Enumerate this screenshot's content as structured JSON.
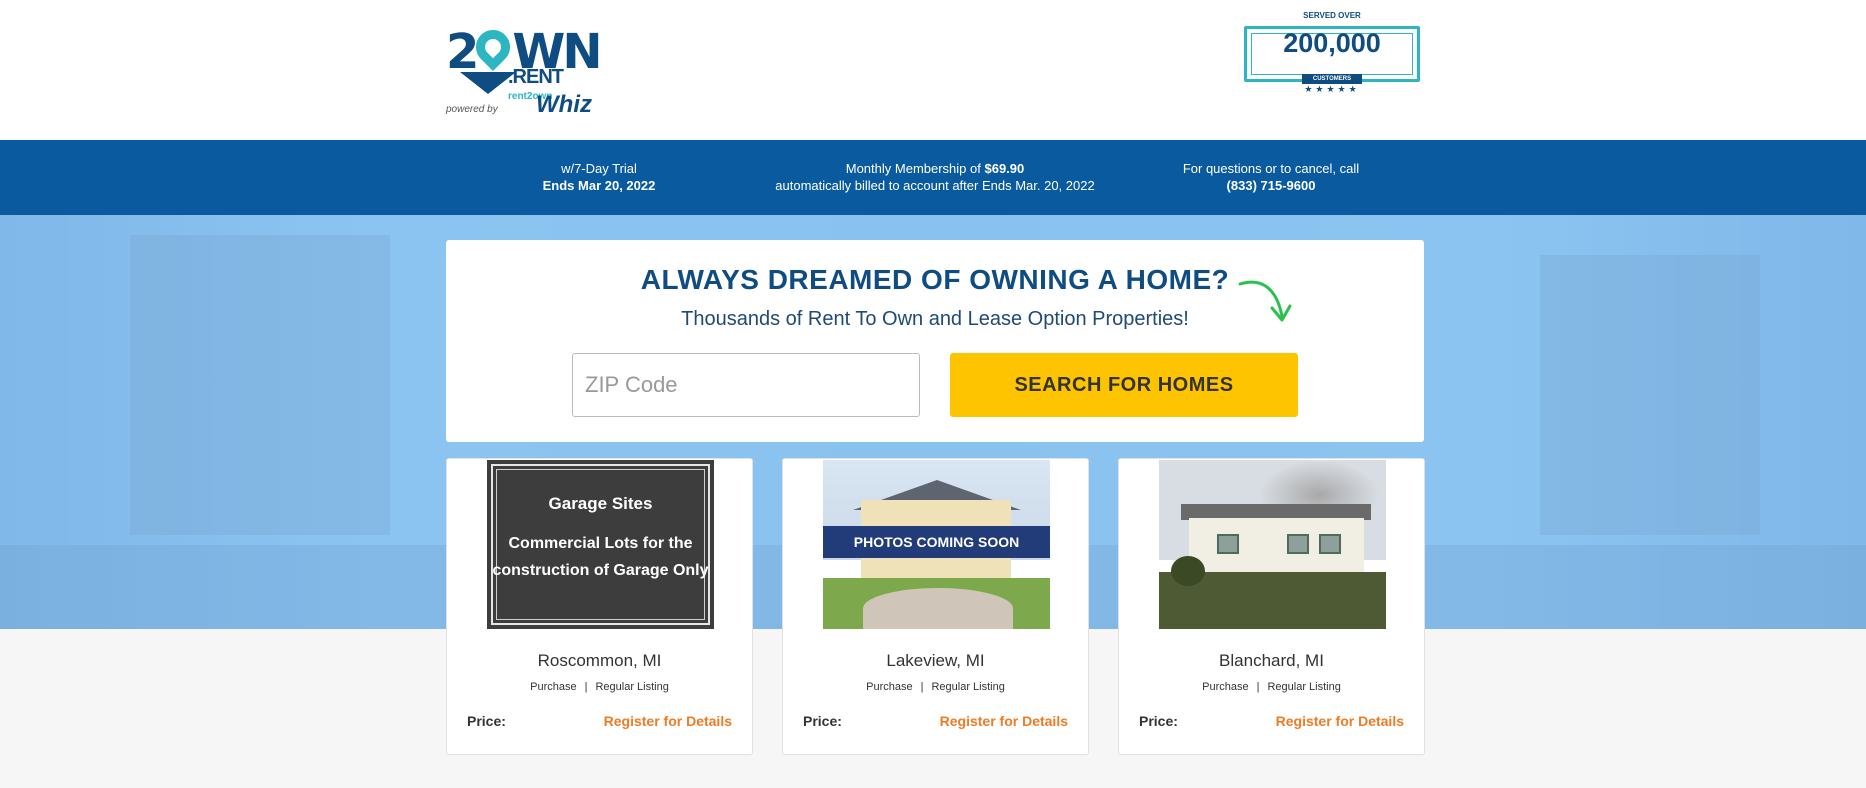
{
  "header": {
    "logo": {
      "brand_top": "2OWN",
      "brand_bottom": ".RENT",
      "powered_by": "powered by",
      "partner_small": "rent2own",
      "partner_main": "Whiz"
    },
    "badge": {
      "top_text": "SERVED OVER",
      "number": "200,000",
      "ribbon": "CUSTOMERS",
      "stars": "★★★★★"
    }
  },
  "infobar": {
    "trial_line1": "w/7-Day Trial",
    "trial_line2": "Ends Mar 20, 2022",
    "membership_prefix": "Monthly Membership of ",
    "membership_price": "$69.90",
    "membership_line2": "automatically billed to account after Ends Mar. 20, 2022",
    "contact_line1": "For questions or to cancel, call",
    "contact_phone": "(833) 715-9600"
  },
  "search": {
    "title": "ALWAYS DREAMED OF OWNING A HOME?",
    "subtitle": "Thousands of Rent To Own and Lease Option Properties!",
    "zip_placeholder": "ZIP Code",
    "zip_value": "",
    "button_label": "SEARCH FOR HOMES"
  },
  "listings": [
    {
      "sign_title": "Garage Sites",
      "sign_body": "Commercial Lots for the construction of Garage Only",
      "city": "Roscommon, MI",
      "type": "Purchase",
      "category": "Regular Listing",
      "price_label": "Price:",
      "price_link": "Register for Details"
    },
    {
      "banner": "PHOTOS COMING SOON",
      "city": "Lakeview, MI",
      "type": "Purchase",
      "category": "Regular Listing",
      "price_label": "Price:",
      "price_link": "Register for Details"
    },
    {
      "city": "Blanchard, MI",
      "type": "Purchase",
      "category": "Regular Listing",
      "price_label": "Price:",
      "price_link": "Register for Details"
    }
  ],
  "colors": {
    "brand_navy": "#0f4c81",
    "brand_teal": "#2bb6c2",
    "infobar": "#0a5aa0",
    "cta_yellow": "#ffc400",
    "link_orange": "#f07b22",
    "hero_blue": "#8ac2ef"
  },
  "icons": {
    "logo_pin": "map-pin-icon",
    "arrow": "curved-arrow-icon",
    "stars": "star-icon"
  }
}
